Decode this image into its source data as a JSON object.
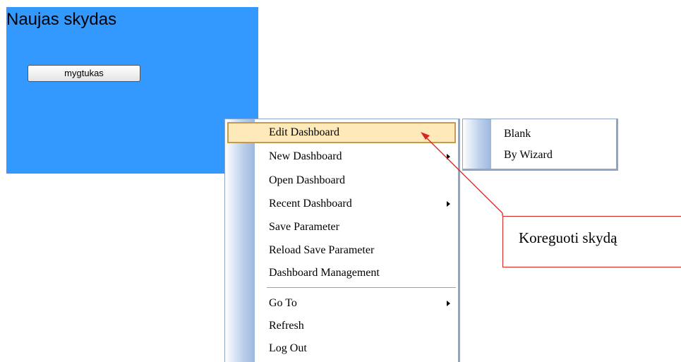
{
  "panel": {
    "title": "Naujas skydas",
    "button_label": "mygtukas",
    "background": "#3399ff"
  },
  "menu": {
    "items": [
      {
        "label": "Edit Dashboard",
        "has_submenu": false,
        "highlighted": true
      },
      {
        "label": "New Dashboard",
        "has_submenu": true,
        "highlighted": false
      },
      {
        "label": "Open Dashboard",
        "has_submenu": false,
        "highlighted": false
      },
      {
        "label": "Recent Dashboard",
        "has_submenu": true,
        "highlighted": false
      },
      {
        "label": "Save Parameter",
        "has_submenu": false,
        "highlighted": false
      },
      {
        "label": "Reload Save Parameter",
        "has_submenu": false,
        "highlighted": false
      },
      {
        "label": "Dashboard Management",
        "has_submenu": false,
        "highlighted": false
      },
      {
        "label": "Go To",
        "has_submenu": true,
        "highlighted": false
      },
      {
        "label": "Refresh",
        "has_submenu": false,
        "highlighted": false
      },
      {
        "label": "Log Out",
        "has_submenu": false,
        "highlighted": false
      }
    ],
    "highlight_color": "#fde9b9"
  },
  "submenu": {
    "items": [
      {
        "label": "Blank"
      },
      {
        "label": "By Wizard"
      }
    ]
  },
  "callout": {
    "text": "Koreguoti skydą",
    "color": "#dd2222"
  }
}
